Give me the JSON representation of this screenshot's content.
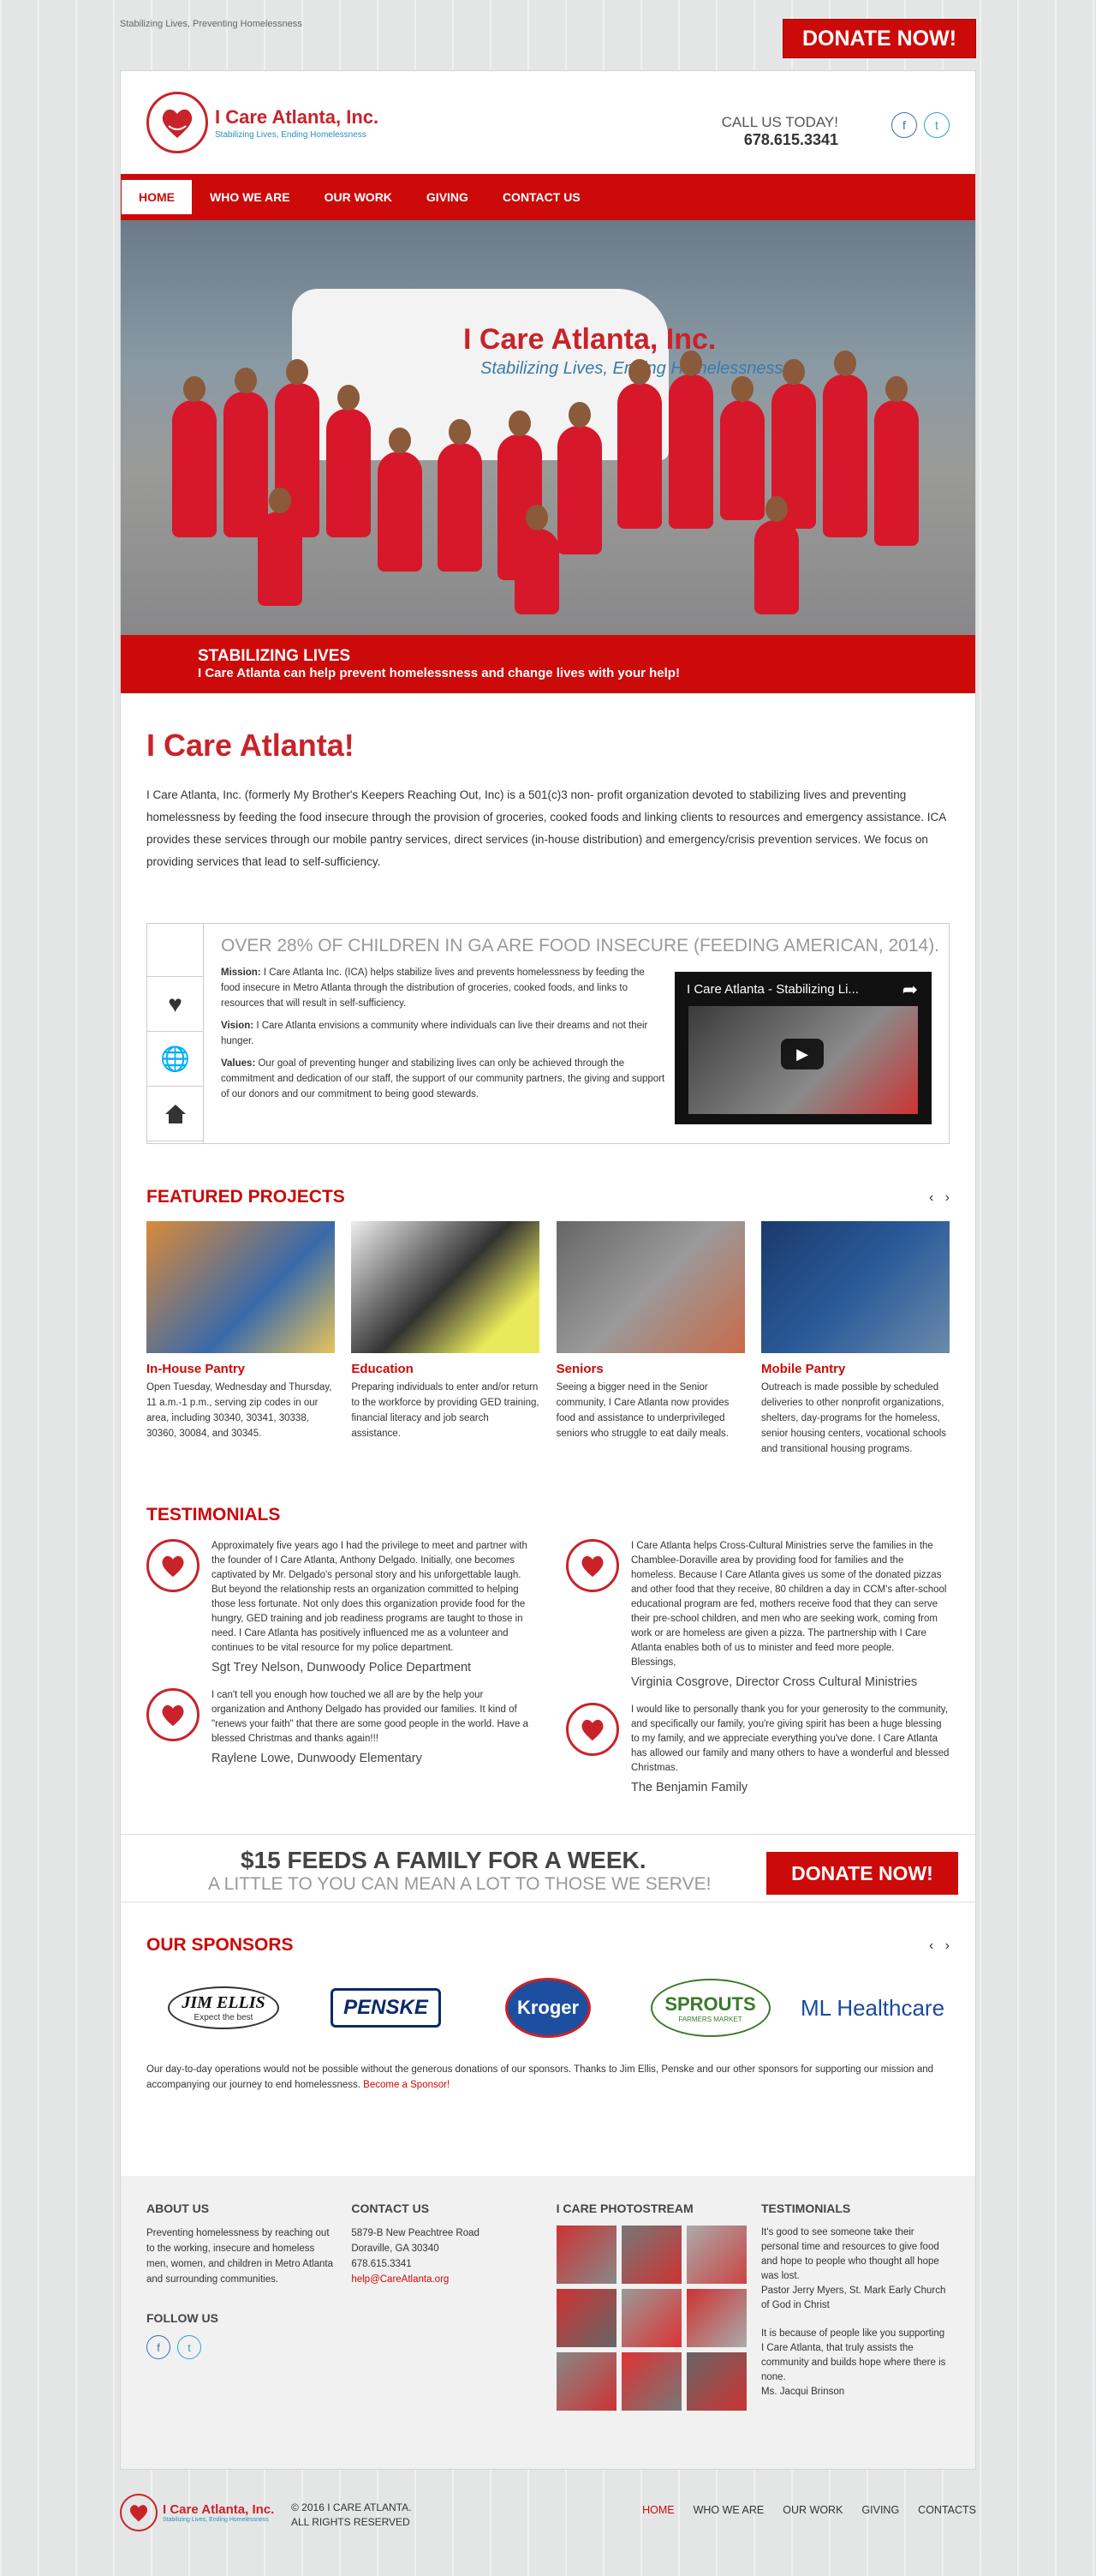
{
  "topbar": {
    "tagline": "Stabilizing Lives, Preventing Homelessness",
    "donate": "DONATE NOW!"
  },
  "header": {
    "logo_title": "I Care Atlanta, Inc.",
    "logo_sub": "Stabilizing Lives, Ending Homelessness",
    "call_label": "CALL US TODAY!",
    "phone": "678.615.3341",
    "facebook_icon": "f",
    "twitter_icon": "t"
  },
  "nav": [
    "HOME",
    "WHO WE ARE",
    "OUR WORK",
    "GIVING",
    "CONTACT US"
  ],
  "hero": {
    "van_text": "I Care Atlanta, Inc.",
    "van_sub": "Stabilizing Lives, Ending Homelessness",
    "caption_title": "STABILIZING LIVES",
    "caption_sub": "I Care Atlanta can help prevent homelessness and change lives with your help!"
  },
  "intro": {
    "title": "I Care Atlanta!",
    "text": "I Care Atlanta, Inc. (formerly My Brother's Keepers Reaching Out, Inc) is a 501(c)3 non- profit organization devoted to stabilizing lives and preventing homelessness by feeding the food insecure through the provision of groceries, cooked foods and linking clients to resources and emergency assistance. ICA provides these services through our mobile pantry services, direct services (in-house distribution) and emergency/crisis prevention services. We focus on providing services that lead to self-sufficiency."
  },
  "mission": {
    "headline": "OVER 28% OF CHILDREN IN GA ARE FOOD INSECURE (FEEDING AMERICAN, 2014).",
    "mission_label": "Mission:",
    "mission_text": " I Care Atlanta Inc. (ICA) helps stabilize lives and prevents homelessness by feeding the food insecure in Metro Atlanta through the distribution of groceries, cooked foods, and links to resources that will result in self-sufficiency.",
    "vision_label": "Vision:",
    "vision_text": " I Care Atlanta envisions a community where individuals can live their dreams and not their hunger.",
    "values_label": "Values:",
    "values_text": " Our goal of preventing hunger and stabilizing lives can only be achieved through the commitment and dedication of our staff, the support of our community partners, the giving and support of our donors and our commitment to being good stewards.",
    "video_title": "I Care Atlanta - Stabilizing Li...",
    "icons": [
      "heart-icon",
      "globe-icon",
      "home-icon"
    ]
  },
  "projects": {
    "title": "FEATURED PROJECTS",
    "items": [
      {
        "title": "In-House Pantry",
        "text": "Open Tuesday, Wednesday and Thursday, 11 a.m.-1 p.m., serving zip codes in our area, including 30340, 30341, 30338, 30360, 30084, and 30345.",
        "color": "#d98a3a"
      },
      {
        "title": "Education",
        "text": "Preparing individuals to enter and/or return to the workforce by providing GED training, financial literacy and job search assistance.",
        "color": "#6a6a6a"
      },
      {
        "title": "Seniors",
        "text": "Seeing a bigger need in the Senior community, I Care Atlanta now provides food and assistance to underprivileged seniors who struggle to eat daily meals.",
        "color": "#7a7a7a"
      },
      {
        "title": "Mobile Pantry",
        "text": "Outreach is made possible by scheduled deliveries to other nonprofit organizations, shelters, day-programs for the homeless, senior housing centers, vocational schools and transitional housing programs.",
        "color": "#2a5a9a"
      }
    ]
  },
  "testimonials": {
    "title": "TESTIMONIALS",
    "left": [
      {
        "text": "Approximately five years ago I had the privilege to meet and partner with the founder of I Care Atlanta, Anthony Delgado. Initially, one becomes captivated by Mr. Delgado's personal story and his unforgettable laugh. But beyond the relationship rests an organization committed to helping those less fortunate. Not only does this organization provide food for the hungry, GED training and job readiness programs are taught to those in need. I Care Atlanta has positively influenced me as a volunteer and continues to be vital resource for my police department.",
        "name": "Sgt Trey Nelson, Dunwoody Police Department"
      },
      {
        "text": "I can't tell you enough how touched we all are by the help your organization and Anthony Delgado has provided our families. It kind of \"renews your faith\" that there are some good people in the world. Have a blessed Christmas and thanks again!!!",
        "name": "Raylene Lowe, Dunwoody Elementary"
      }
    ],
    "right": [
      {
        "text": "I Care Atlanta helps Cross-Cultural Ministries serve the families in the Chamblee-Doraville area by providing food for families and the homeless.  Because I Care Atlanta gives us some of the donated pizzas and other food that they receive, 80 children a day in CCM's after-school educational program are fed, mothers receive food that they can serve their pre-school children, and men who are seeking work, coming from work or are homeless are given a pizza.  The partnership with I Care Atlanta enables both of us to minister and feed more people.\nBlessings,",
        "name": "Virginia Cosgrove, Director Cross Cultural Ministries"
      },
      {
        "text": "I would like to personally thank you for your generosity to the community, and specifically our family, you're giving spirit has been a huge blessing to my family, and we appreciate everything you've done. I Care Atlanta has allowed our family and many others to have a wonderful and blessed Christmas.",
        "name": "The Benjamin Family"
      }
    ]
  },
  "feeds": {
    "line1": "$15 FEEDS A FAMILY FOR A WEEK.",
    "line2": "A LITTLE TO YOU CAN MEAN A LOT TO THOSE WE SERVE!",
    "donate": "DONATE NOW!"
  },
  "sponsors": {
    "title": "OUR SPONSORS",
    "items": [
      "JIM ELLIS",
      "PENSKE",
      "Kroger",
      "SPROUTS",
      "ML Healthcare"
    ],
    "jim_tag": "Expect the best",
    "sprouts_tag": "FARMERS MARKET",
    "text": "Our day-to-day operations would not be possible without the generous donations of our sponsors. Thanks to Jim Ellis, Penske and our other sponsors for supporting our mission and accompanying our journey to end homelessness. ",
    "link": "Become a Sponsor!"
  },
  "footer": {
    "about_title": "ABOUT US",
    "about_text": "Preventing homelessness by reaching out to the working, insecure and homeless men, women, and children in Metro Atlanta and surrounding communities.",
    "follow_title": "FOLLOW US",
    "contact_title": "CONTACT US",
    "address1": "5879-B New Peachtree Road",
    "address2": "Doraville, GA 30340",
    "phone": "678.615.3341",
    "email": "help@CareAtlanta.org",
    "photo_title": "I CARE PHOTOSTREAM",
    "testi_title": "TESTIMONIALS",
    "testi1_text": "It's good to see someone take their personal time and resources to give food and hope to people who thought all hope was lost.",
    "testi1_author": "Pastor Jerry Myers, St. Mark Early Church of God in Christ",
    "testi2_text": "It is because of people like you supporting I Care Atlanta, that truly assists the community and builds hope where there is none.",
    "testi2_author": "Ms. Jacqui Brinson"
  },
  "bottom": {
    "logo_title": "I Care Atlanta, Inc.",
    "logo_sub": "Stabilizing Lives, Ending Homelessness",
    "copy1": "© 2016 I CARE ATLANTA.",
    "copy2": "ALL RIGHTS RESERVED",
    "nav": [
      "HOME",
      "WHO WE ARE",
      "OUR WORK",
      "GIVING",
      "CONTACTS"
    ]
  },
  "colors": {
    "brand_red": "#cc0a0a",
    "logo_blue": "#2a8fb8"
  }
}
